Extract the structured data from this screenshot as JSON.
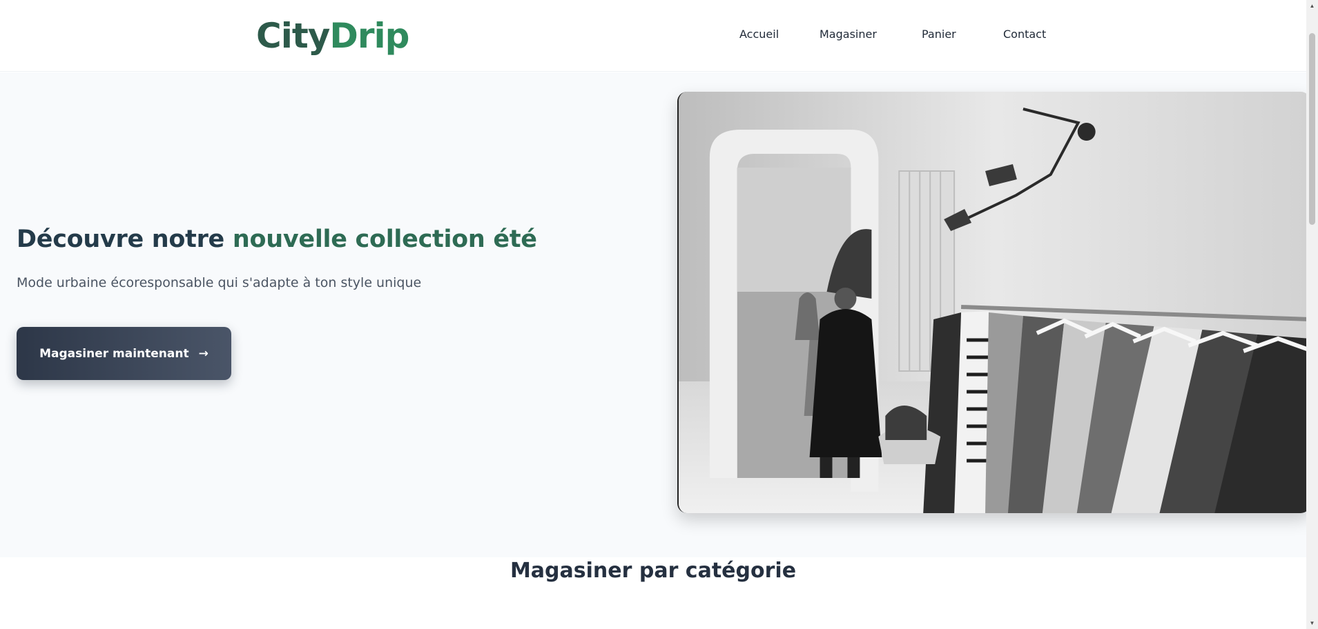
{
  "brand": {
    "part1": "City",
    "part2": "Drip"
  },
  "nav": [
    {
      "label": "Accueil"
    },
    {
      "label": "Magasiner"
    },
    {
      "label": "Panier"
    },
    {
      "label": "Contact"
    }
  ],
  "hero": {
    "title_start": "Découvre notre ",
    "title_accent": "nouvelle collection été",
    "subtitle": "Mode urbaine écoresponsable qui s'adapte à ton style unique",
    "cta_label": "Magasiner maintenant",
    "cta_arrow": "→",
    "image_icon": "clothing-store-photo"
  },
  "categories": {
    "title": "Magasiner par catégorie"
  },
  "scrollbar": {
    "up_icon": "▲",
    "down_icon": "▼"
  },
  "colors": {
    "brand_dark": "#2d5a4a",
    "brand_green": "#2f8a5d",
    "title_dark": "#243b4a",
    "title_accent": "#2e6b54",
    "cta_start": "#2d3748",
    "cta_end": "#4a5568",
    "hero_bg": "#f8fafc"
  }
}
